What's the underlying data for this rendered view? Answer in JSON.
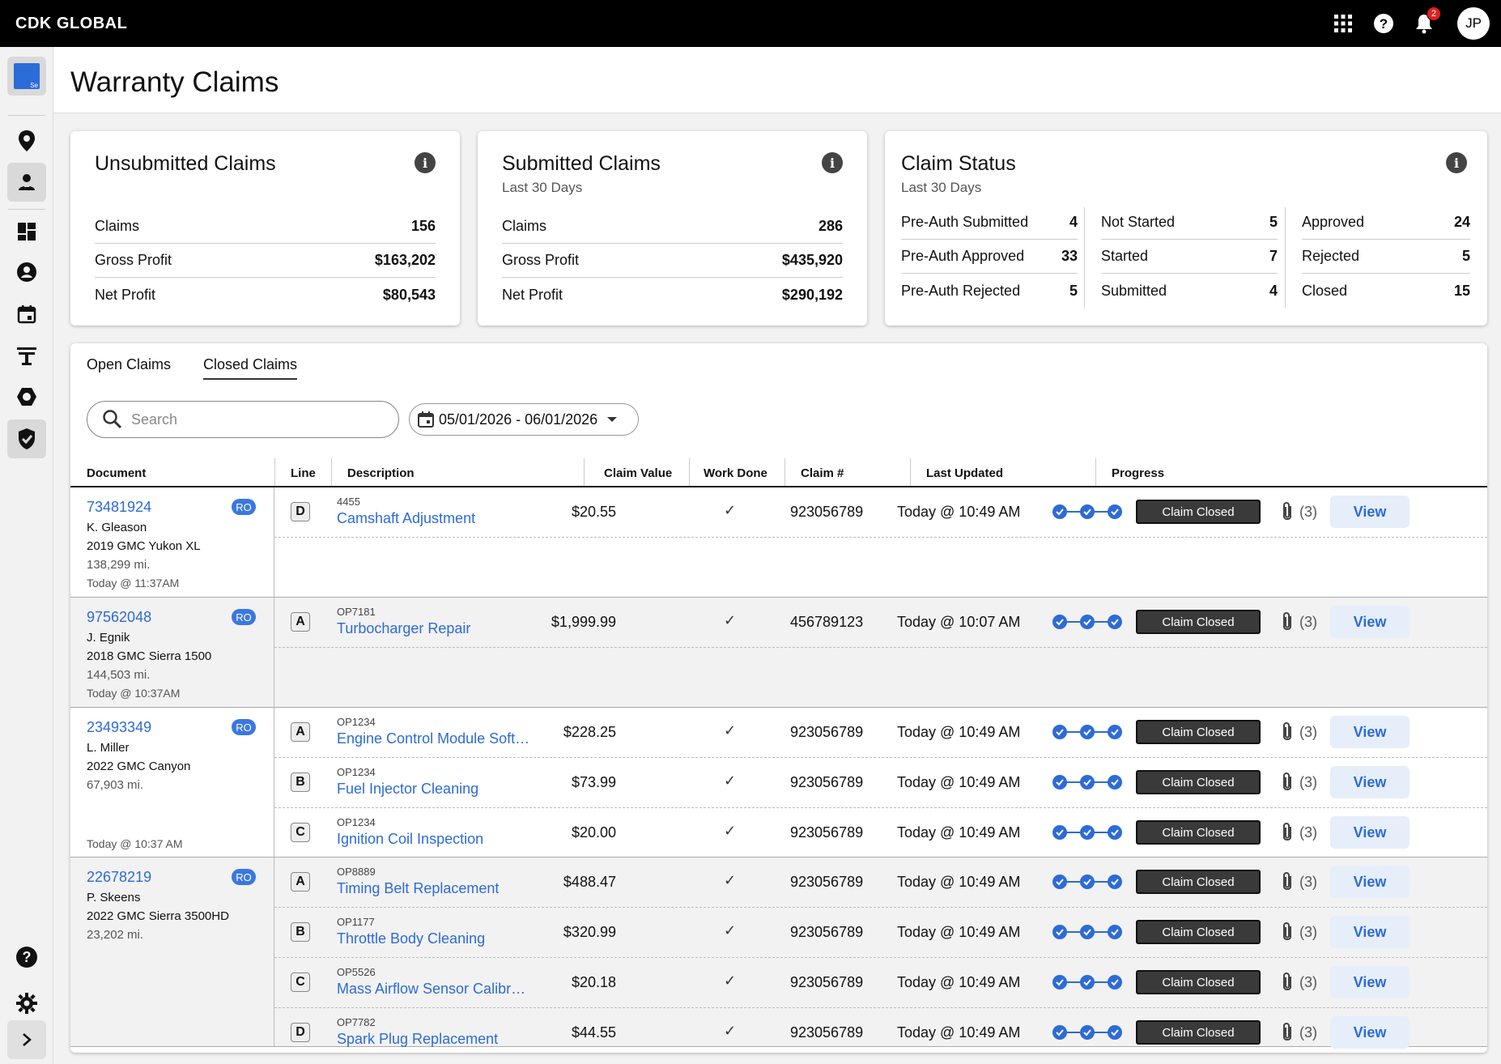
{
  "brand": "CDK GLOBAL",
  "user_initials": "JP",
  "notification_count": "2",
  "app_tile_label": "Se",
  "page_title": "Warranty Claims",
  "cards": {
    "unsubmitted": {
      "title": "Unsubmitted Claims",
      "rows": [
        {
          "label": "Claims",
          "value": "156"
        },
        {
          "label": "Gross Profit",
          "value": "$163,202"
        },
        {
          "label": "Net Profit",
          "value": "$80,543"
        }
      ]
    },
    "submitted": {
      "title": "Submitted Claims",
      "subtitle": "Last 30 Days",
      "rows": [
        {
          "label": "Claims",
          "value": "286"
        },
        {
          "label": "Gross Profit",
          "value": "$435,920"
        },
        {
          "label": "Net Profit",
          "value": "$290,192"
        }
      ]
    },
    "status": {
      "title": "Claim Status",
      "subtitle": "Last 30 Days",
      "columns": [
        [
          {
            "label": "Pre-Auth Submitted",
            "value": "4"
          },
          {
            "label": "Pre-Auth Approved",
            "value": "33"
          },
          {
            "label": "Pre-Auth Rejected",
            "value": "5"
          }
        ],
        [
          {
            "label": "Not Started",
            "value": "5"
          },
          {
            "label": "Started",
            "value": "7"
          },
          {
            "label": "Submitted",
            "value": "4"
          }
        ],
        [
          {
            "label": "Approved",
            "value": "24"
          },
          {
            "label": "Rejected",
            "value": "5"
          },
          {
            "label": "Closed",
            "value": "15"
          }
        ]
      ]
    }
  },
  "tabs": [
    "Open Claims",
    "Closed Claims"
  ],
  "search": {
    "placeholder": "Search"
  },
  "date_range": "05/01/2026 - 06/01/2026",
  "columns": [
    "Document",
    "Line",
    "Description",
    "Claim Value",
    "Work Done",
    "Claim #",
    "Last Updated",
    "Progress"
  ],
  "colors": {
    "accent": "#2d6bd6",
    "ro_badge": "#3a78e0",
    "status_pill": "#3a3a3a",
    "view_bg": "#e6eef9"
  },
  "groups": [
    {
      "document": "73481924",
      "badge": "RO",
      "customer": "K. Gleason",
      "vehicle": "2019 GMC Yukon XL",
      "mileage": "138,299 mi.",
      "time": "Today @ 11:37AM",
      "lines": [
        {
          "letter": "D",
          "op": "4455",
          "description": "Camshaft Adjustment",
          "value": "$20.55",
          "work_done": "✓",
          "claim": "923056789",
          "updated": "Today @ 10:49 AM",
          "status": "Claim Closed",
          "attachments": "(3)",
          "action": "View"
        }
      ]
    },
    {
      "document": "97562048",
      "badge": "RO",
      "customer": "J. Egnik",
      "vehicle": "2018 GMC Sierra 1500",
      "mileage": "144,503 mi.",
      "time": "Today @ 10:37AM",
      "lines": [
        {
          "letter": "A",
          "op": "OP7181",
          "description": "Turbocharger Repair",
          "value": "$1,999.99",
          "work_done": "✓",
          "claim": "456789123",
          "updated": "Today @ 10:07 AM",
          "status": "Claim Closed",
          "attachments": "(3)",
          "action": "View"
        }
      ]
    },
    {
      "document": "23493349",
      "badge": "RO",
      "customer": "L. Miller",
      "vehicle": "2022 GMC Canyon",
      "mileage": "67,903 mi.",
      "time": "Today @ 10:37 AM",
      "lines": [
        {
          "letter": "A",
          "op": "OP1234",
          "description": "Engine Control Module Software...",
          "value": "$228.25",
          "work_done": "✓",
          "claim": "923056789",
          "updated": "Today @ 10:49 AM",
          "status": "Claim Closed",
          "attachments": "(3)",
          "action": "View"
        },
        {
          "letter": "B",
          "op": "OP1234",
          "description": "Fuel Injector Cleaning",
          "value": "$73.99",
          "work_done": "✓",
          "claim": "923056789",
          "updated": "Today @ 10:49 AM",
          "status": "Claim Closed",
          "attachments": "(3)",
          "action": "View"
        },
        {
          "letter": "C",
          "op": "OP1234",
          "description": "Ignition Coil Inspection",
          "value": "$20.00",
          "work_done": "✓",
          "claim": "923056789",
          "updated": "Today @ 10:49 AM",
          "status": "Claim Closed",
          "attachments": "(3)",
          "action": "View"
        }
      ]
    },
    {
      "document": "22678219",
      "badge": "RO",
      "customer": "P. Skeens",
      "vehicle": "2022 GMC Sierra 3500HD",
      "mileage": "23,202 mi.",
      "time": "",
      "lines": [
        {
          "letter": "A",
          "op": "OP8889",
          "description": "Timing Belt Replacement",
          "value": "$488.47",
          "work_done": "✓",
          "claim": "923056789",
          "updated": "Today @ 10:49 AM",
          "status": "Claim Closed",
          "attachments": "(3)",
          "action": "View"
        },
        {
          "letter": "B",
          "op": "OP1177",
          "description": "Throttle Body Cleaning",
          "value": "$320.99",
          "work_done": "✓",
          "claim": "923056789",
          "updated": "Today @ 10:49 AM",
          "status": "Claim Closed",
          "attachments": "(3)",
          "action": "View"
        },
        {
          "letter": "C",
          "op": "OP5526",
          "description": "Mass Airflow Sensor Calibration",
          "value": "$20.18",
          "work_done": "✓",
          "claim": "923056789",
          "updated": "Today @ 10:49 AM",
          "status": "Claim Closed",
          "attachments": "(3)",
          "action": "View"
        },
        {
          "letter": "D",
          "op": "OP7782",
          "description": "Spark Plug Replacement",
          "value": "$44.55",
          "work_done": "✓",
          "claim": "923056789",
          "updated": "Today @ 10:49 AM",
          "status": "Claim Closed",
          "attachments": "(3)",
          "action": "View"
        }
      ]
    }
  ]
}
